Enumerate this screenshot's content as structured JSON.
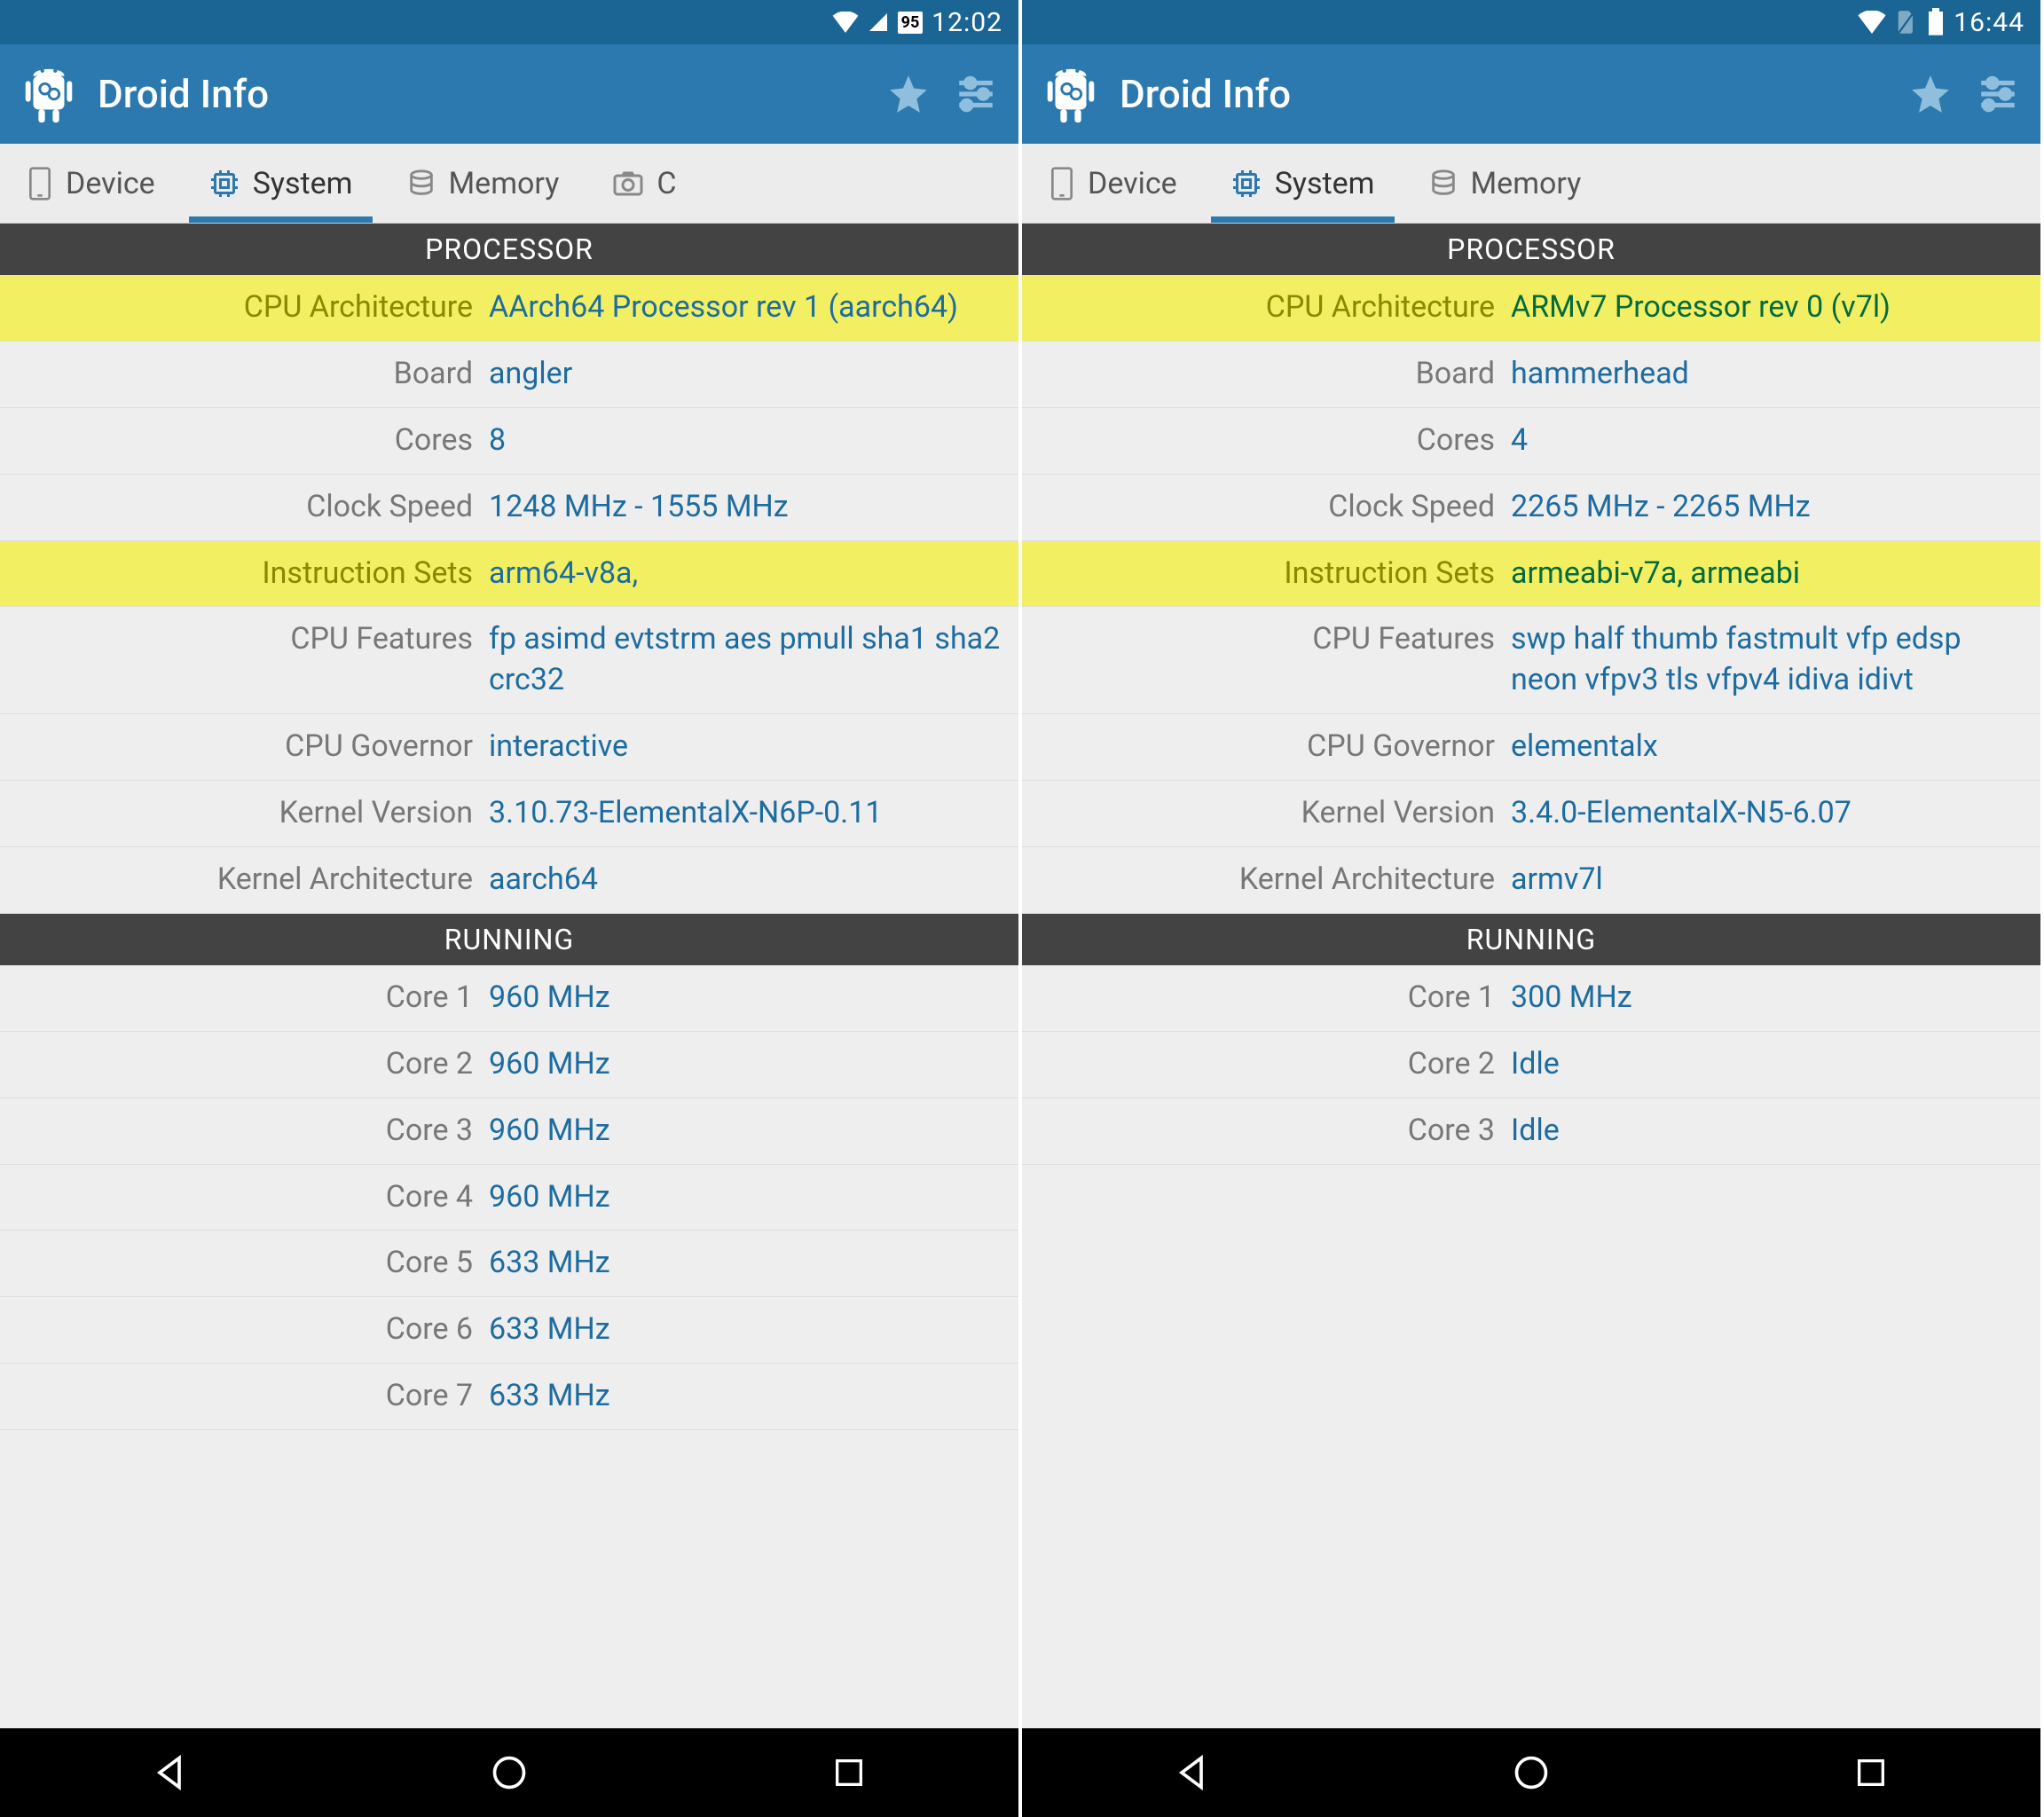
{
  "left": {
    "status": {
      "time": "12:02",
      "battery_level": "95"
    },
    "header": {
      "title": "Droid Info"
    },
    "tabs": [
      "Device",
      "System",
      "Memory",
      "C"
    ],
    "active_tab": 1,
    "sections": {
      "processor_title": "PROCESSOR",
      "running_title": "RUNNING"
    },
    "processor": [
      {
        "label": "CPU Architecture",
        "value": "AArch64 Processor rev 1 (aarch64)",
        "hl": true
      },
      {
        "label": "Board",
        "value": "angler"
      },
      {
        "label": "Cores",
        "value": "8"
      },
      {
        "label": "Clock Speed",
        "value": "1248 MHz - 1555 MHz"
      },
      {
        "label": "Instruction Sets",
        "value": "arm64-v8a,",
        "hl": true
      },
      {
        "label": "CPU Features",
        "value": "fp asimd evtstrm aes pmull sha1 sha2 crc32"
      },
      {
        "label": "CPU Governor",
        "value": "interactive"
      },
      {
        "label": "Kernel Version",
        "value": "3.10.73-ElementalX-N6P-0.11"
      },
      {
        "label": "Kernel Architecture",
        "value": "aarch64"
      }
    ],
    "running": [
      {
        "label": "Core 1",
        "value": "960 MHz"
      },
      {
        "label": "Core 2",
        "value": "960 MHz"
      },
      {
        "label": "Core 3",
        "value": "960 MHz"
      },
      {
        "label": "Core 4",
        "value": "960 MHz"
      },
      {
        "label": "Core 5",
        "value": "633 MHz"
      },
      {
        "label": "Core 6",
        "value": "633 MHz"
      },
      {
        "label": "Core 7",
        "value": "633 MHz"
      }
    ]
  },
  "right": {
    "status": {
      "time": "16:44"
    },
    "header": {
      "title": "Droid Info"
    },
    "tabs": [
      "Device",
      "System",
      "Memory"
    ],
    "active_tab": 1,
    "sections": {
      "processor_title": "PROCESSOR",
      "running_title": "RUNNING"
    },
    "processor": [
      {
        "label": "CPU Architecture",
        "value": "ARMv7 Processor rev 0 (v7l)",
        "hl": true
      },
      {
        "label": "Board",
        "value": "hammerhead"
      },
      {
        "label": "Cores",
        "value": "4"
      },
      {
        "label": "Clock Speed",
        "value": "2265 MHz - 2265 MHz"
      },
      {
        "label": "Instruction Sets",
        "value": "armeabi-v7a, armeabi",
        "hl": true
      },
      {
        "label": "CPU Features",
        "value": "swp half thumb fastmult vfp edsp neon vfpv3 tls vfpv4 idiva idivt"
      },
      {
        "label": "CPU Governor",
        "value": "elementalx"
      },
      {
        "label": "Kernel Version",
        "value": "3.4.0-ElementalX-N5-6.07"
      },
      {
        "label": "Kernel Architecture",
        "value": "armv7l"
      }
    ],
    "running": [
      {
        "label": "Core 1",
        "value": "300 MHz"
      },
      {
        "label": "Core 2",
        "value": "Idle"
      },
      {
        "label": "Core 3",
        "value": "Idle"
      }
    ]
  }
}
